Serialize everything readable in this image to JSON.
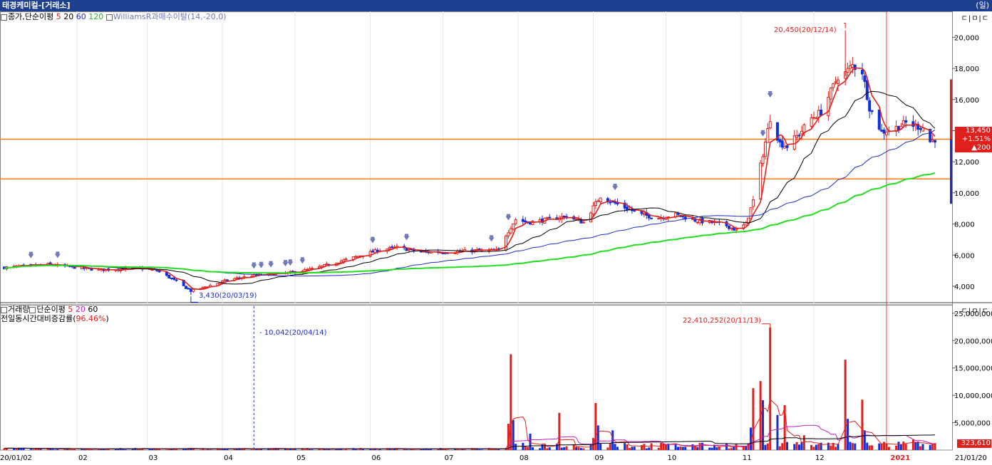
{
  "window": {
    "title": "태경케미컬-[거래소]",
    "period": "(일)",
    "tools": "ㄷ|ㅁ|ㄷ",
    "tools2": "ㄷ|ㅁ|ㄷ"
  },
  "legend_price": {
    "name": "종가,단순이평",
    "ma5": "5",
    "ma20": "20",
    "ma60": "60",
    "ma120": "120",
    "williams": "WilliamsR과매수이탈(14,-20,0)"
  },
  "legend_volume": {
    "name": "거래량",
    "ma_name": "단순이평",
    "ma5": "5",
    "ma20": "20",
    "ma60": "60",
    "line2_label": "전일동시간대비증감률(",
    "line2_value": "96.46%",
    "line2_close": ")"
  },
  "annotations": {
    "price_high": "20,450(20/12/14)",
    "price_low": "3,430(20/03/19)",
    "volume_high": "22,410,252(20/11/13)",
    "volume_marker": "10,042(20/04/14)"
  },
  "price_box": {
    "price": "13,450",
    "change_pct": "+1.51%",
    "change_abs": "▲200"
  },
  "volume_box": {
    "value": "323,610"
  },
  "colors": {
    "up": "#e0201d",
    "down": "#1030d8",
    "ma5": "#e0201d",
    "ma20": "#000000",
    "ma60": "#1c2cc8",
    "ma120": "#22dd22",
    "hline": "#ff7a1a",
    "vline": "#e04040",
    "marker": "#7079b8"
  },
  "chart_data": [
    {
      "type": "candlestick",
      "title": "태경케미컬 일봉",
      "ylabel": "",
      "ylim": [
        2900,
        21300
      ],
      "y_ticks": [
        4000,
        6000,
        8000,
        10000,
        12000,
        14000,
        16000,
        18000,
        20000
      ],
      "y_tick_labels": [
        "4,000",
        "6,000",
        "8,000",
        "10,000",
        "12,000",
        "14,000",
        "16,000",
        "18,000",
        "20,000"
      ],
      "x_ticks": [
        "20/01/02",
        "02",
        "03",
        "04",
        "05",
        "06",
        "07",
        "08",
        "09",
        "10",
        "11",
        "12",
        "2021",
        "21/01/20"
      ],
      "horizontal_lines": [
        13450,
        10900
      ],
      "price_path": [
        [
          "2020-01-02",
          5200
        ],
        [
          "2020-01-20",
          5400
        ],
        [
          "2020-02-10",
          5050
        ],
        [
          "2020-02-28",
          5150
        ],
        [
          "2020-03-05",
          5000
        ],
        [
          "2020-03-12",
          4400
        ],
        [
          "2020-03-19",
          3700
        ],
        [
          "2020-03-26",
          4000
        ],
        [
          "2020-04-03",
          4400
        ],
        [
          "2020-04-14",
          4700
        ],
        [
          "2020-04-28",
          4850
        ],
        [
          "2020-05-08",
          5100
        ],
        [
          "2020-05-22",
          5700
        ],
        [
          "2020-06-04",
          6300
        ],
        [
          "2020-06-12",
          6500
        ],
        [
          "2020-06-22",
          6200
        ],
        [
          "2020-07-03",
          6200
        ],
        [
          "2020-07-15",
          6300
        ],
        [
          "2020-07-24",
          6300
        ],
        [
          "2020-07-27",
          7300
        ],
        [
          "2020-07-31",
          8300
        ],
        [
          "2020-08-05",
          8100
        ],
        [
          "2020-08-14",
          8300
        ],
        [
          "2020-08-21",
          8500
        ],
        [
          "2020-08-28",
          8100
        ],
        [
          "2020-09-04",
          9800
        ],
        [
          "2020-09-09",
          9400
        ],
        [
          "2020-09-15",
          9000
        ],
        [
          "2020-09-21",
          8600
        ],
        [
          "2020-09-28",
          8400
        ],
        [
          "2020-10-05",
          8600
        ],
        [
          "2020-10-14",
          8200
        ],
        [
          "2020-10-20",
          8100
        ],
        [
          "2020-10-26",
          7900
        ],
        [
          "2020-10-30",
          7600
        ],
        [
          "2020-11-03",
          8000
        ],
        [
          "2020-11-06",
          9500
        ],
        [
          "2020-11-10",
          12500
        ],
        [
          "2020-11-13",
          14800
        ],
        [
          "2020-11-17",
          13200
        ],
        [
          "2020-11-20",
          13000
        ],
        [
          "2020-11-25",
          13800
        ],
        [
          "2020-11-30",
          14800
        ],
        [
          "2020-12-04",
          15200
        ],
        [
          "2020-12-08",
          16500
        ],
        [
          "2020-12-11",
          17500
        ],
        [
          "2020-12-14",
          17700
        ],
        [
          "2020-12-17",
          18200
        ],
        [
          "2020-12-21",
          17800
        ],
        [
          "2020-12-24",
          15500
        ],
        [
          "2020-12-29",
          13900
        ],
        [
          "2021-01-04",
          14200
        ],
        [
          "2021-01-08",
          14500
        ],
        [
          "2021-01-12",
          14300
        ],
        [
          "2021-01-15",
          14200
        ],
        [
          "2021-01-18",
          13300
        ],
        [
          "2021-01-20",
          13450
        ]
      ],
      "series": [
        {
          "name": "5",
          "values": []
        },
        {
          "name": "20",
          "values": []
        },
        {
          "name": "60",
          "values": []
        },
        {
          "name": "120",
          "values": []
        }
      ],
      "high": {
        "date": "2020-12-14",
        "value": 20450
      },
      "low": {
        "date": "2020-03-19",
        "value": 3430
      },
      "last": 13450
    },
    {
      "type": "bar",
      "title": "거래량",
      "ylim": [
        0,
        25500000
      ],
      "y_ticks": [
        5000000,
        10000000,
        15000000,
        20000000,
        25000000
      ],
      "y_tick_labels": [
        "5,000,000",
        "10,000,000",
        "15,000,000",
        "20,000,000",
        "25,000,000"
      ],
      "spikes": [
        [
          "2020-07-28",
          4800000,
          "up"
        ],
        [
          "2020-07-29",
          17500000,
          "up"
        ],
        [
          "2020-07-30",
          5500000,
          "down"
        ],
        [
          "2020-08-06",
          3000000,
          "down"
        ],
        [
          "2020-08-18",
          6800000,
          "up"
        ],
        [
          "2020-09-01",
          2200000,
          "up"
        ],
        [
          "2020-09-02",
          8600000,
          "up"
        ],
        [
          "2020-09-03",
          4500000,
          "down"
        ],
        [
          "2020-09-09",
          3600000,
          "down"
        ],
        [
          "2020-11-05",
          4100000,
          "down"
        ],
        [
          "2020-11-06",
          11300000,
          "up"
        ],
        [
          "2020-11-09",
          12600000,
          "up"
        ],
        [
          "2020-11-10",
          9100000,
          "down"
        ],
        [
          "2020-11-13",
          22410252,
          "up"
        ],
        [
          "2020-11-16",
          6400000,
          "down"
        ],
        [
          "2020-11-19",
          8200000,
          "up"
        ],
        [
          "2020-11-27",
          2700000,
          "up"
        ],
        [
          "2020-12-14",
          16500000,
          "up"
        ],
        [
          "2020-12-15",
          5700000,
          "down"
        ],
        [
          "2020-12-21",
          9200000,
          "up"
        ],
        [
          "2020-12-22",
          3600000,
          "down"
        ],
        [
          "2021-01-11",
          1900000,
          "up"
        ]
      ],
      "last": 323610
    }
  ]
}
